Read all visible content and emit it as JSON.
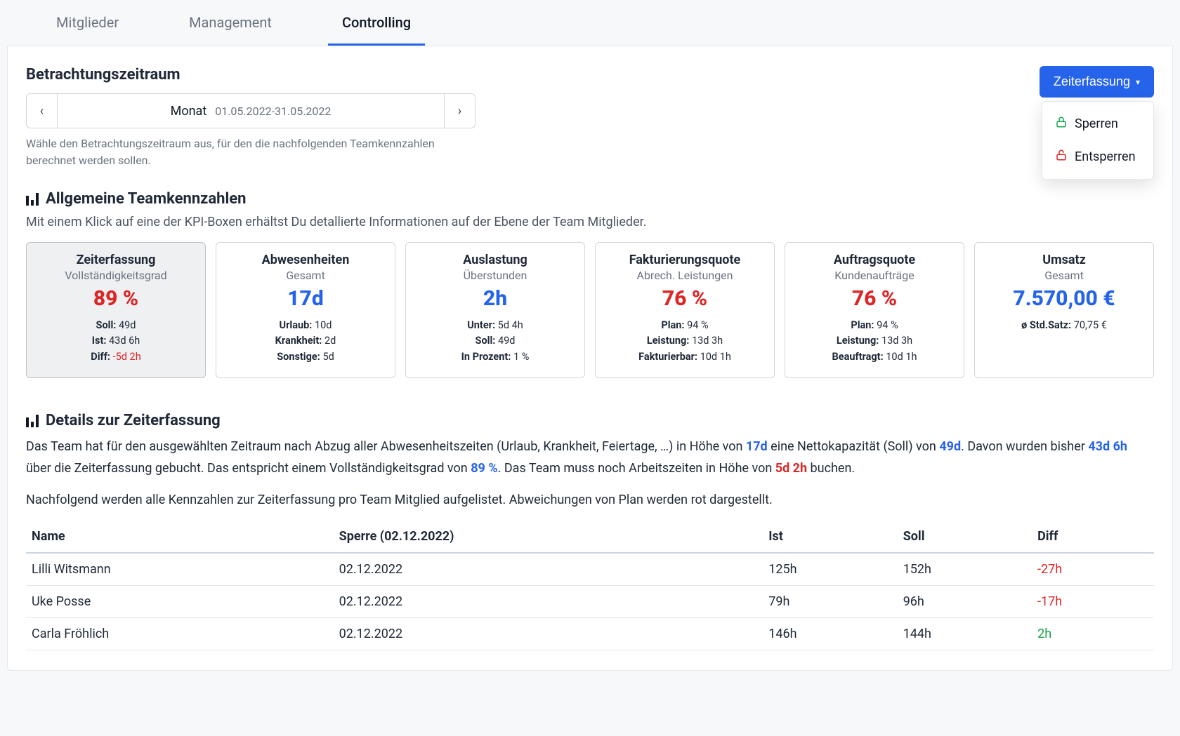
{
  "tabs": {
    "items": [
      "Mitglieder",
      "Management",
      "Controlling"
    ],
    "activeIndex": 2
  },
  "period": {
    "title": "Betrachtungszeitraum",
    "unit": "Monat",
    "range": "01.05.2022-31.05.2022",
    "hint": "Wähle den Betrachtungszeitraum aus, für den die nachfolgenden Teamkennzahlen berechnet werden sollen."
  },
  "timeTracking": {
    "button": "Zeiterfassung",
    "menu": {
      "lock": "Sperren",
      "unlock": "Entsperren"
    }
  },
  "sections": {
    "kpiTitle": "Allgemeine Teamkennzahlen",
    "kpiSub": "Mit einem Klick auf eine der KPI-Boxen erhältst Du detallierte Informationen auf der Ebene der Team Mitglieder.",
    "detailsTitle": "Details zur Zeiterfassung"
  },
  "kpi": [
    {
      "id": "zeiterfassung",
      "selected": true,
      "title": "Zeiterfassung",
      "sub": "Vollständigkeitsgrad",
      "value": "89 %",
      "color": "red",
      "lines": [
        {
          "label": "Soll:",
          "value": " 49d",
          "cls": ""
        },
        {
          "label": "Ist:",
          "value": " 43d 6h",
          "cls": ""
        },
        {
          "label": "Diff:",
          "value": " -5d 2h",
          "cls": "diff-red"
        }
      ]
    },
    {
      "id": "abwesenheiten",
      "title": "Abwesenheiten",
      "sub": "Gesamt",
      "value": "17d",
      "color": "blue",
      "lines": [
        {
          "label": "Urlaub:",
          "value": " 10d",
          "cls": ""
        },
        {
          "label": "Krankheit:",
          "value": " 2d",
          "cls": ""
        },
        {
          "label": "Sonstige:",
          "value": " 5d",
          "cls": ""
        }
      ]
    },
    {
      "id": "auslastung",
      "title": "Auslastung",
      "sub": "Überstunden",
      "value": "2h",
      "color": "blue",
      "lines": [
        {
          "label": "Unter:",
          "value": " 5d 4h",
          "cls": ""
        },
        {
          "label": "Soll:",
          "value": " 49d",
          "cls": ""
        },
        {
          "label": "In Prozent:",
          "value": " 1 %",
          "cls": ""
        }
      ]
    },
    {
      "id": "fakturierungsquote",
      "title": "Fakturierungsquote",
      "sub": "Abrech. Leistungen",
      "value": "76 %",
      "color": "red",
      "lines": [
        {
          "label": "Plan:",
          "value": " 94 %",
          "cls": ""
        },
        {
          "label": "Leistung:",
          "value": " 13d 3h",
          "cls": ""
        },
        {
          "label": "Fakturierbar:",
          "value": " 10d 1h",
          "cls": ""
        }
      ]
    },
    {
      "id": "auftragsquote",
      "title": "Auftragsquote",
      "sub": "Kundenaufträge",
      "value": "76 %",
      "color": "red",
      "lines": [
        {
          "label": "Plan:",
          "value": " 94 %",
          "cls": ""
        },
        {
          "label": "Leistung:",
          "value": " 13d 3h",
          "cls": ""
        },
        {
          "label": "Beauftragt:",
          "value": " 10d 1h",
          "cls": ""
        }
      ]
    },
    {
      "id": "umsatz",
      "title": "Umsatz",
      "sub": "Gesamt",
      "value": "7.570,00 €",
      "color": "blue",
      "lines": [
        {
          "label": "ø Std.Satz:",
          "value": " 70,75 €",
          "cls": ""
        }
      ]
    }
  ],
  "details": {
    "p1_segments": [
      {
        "t": "Das Team hat für den ausgewählten Zeitraum nach Abzug aller Abwesenheitszeiten (Urlaub, Krankheit, Feiertage, …) in Höhe von ",
        "cls": ""
      },
      {
        "t": "17d",
        "cls": "hl-blue"
      },
      {
        "t": " eine Nettokapazität (Soll) von ",
        "cls": ""
      },
      {
        "t": "49d",
        "cls": "hl-blue"
      },
      {
        "t": ". Davon wurden bisher ",
        "cls": ""
      },
      {
        "t": "43d 6h",
        "cls": "hl-blue"
      },
      {
        "t": " über die Zeiterfassung gebucht. Das entspricht einem Vollständigkeitsgrad von ",
        "cls": ""
      },
      {
        "t": "89 %",
        "cls": "hl-blue"
      },
      {
        "t": ". Das Team muss noch Arbeitszeiten in Höhe von ",
        "cls": ""
      },
      {
        "t": "5d 2h",
        "cls": "hl-red"
      },
      {
        "t": " buchen.",
        "cls": ""
      }
    ],
    "p2": "Nachfolgend werden alle Kennzahlen zur Zeiterfassung pro Team Mitglied aufgelistet. Abweichungen von Plan werden rot dargestellt."
  },
  "table": {
    "columns": [
      "Name",
      "Sperre (02.12.2022)",
      "Ist",
      "Soll",
      "Diff"
    ],
    "rows": [
      {
        "name": "Lilli Witsmann",
        "lock": "02.12.2022",
        "ist": "125h",
        "soll": "152h",
        "diff": "-27h",
        "diffCls": "diff-neg"
      },
      {
        "name": "Uke Posse",
        "lock": "02.12.2022",
        "ist": "79h",
        "soll": "96h",
        "diff": "-17h",
        "diffCls": "diff-neg"
      },
      {
        "name": "Carla Fröhlich",
        "lock": "02.12.2022",
        "ist": "146h",
        "soll": "144h",
        "diff": "2h",
        "diffCls": "diff-pos"
      }
    ]
  }
}
